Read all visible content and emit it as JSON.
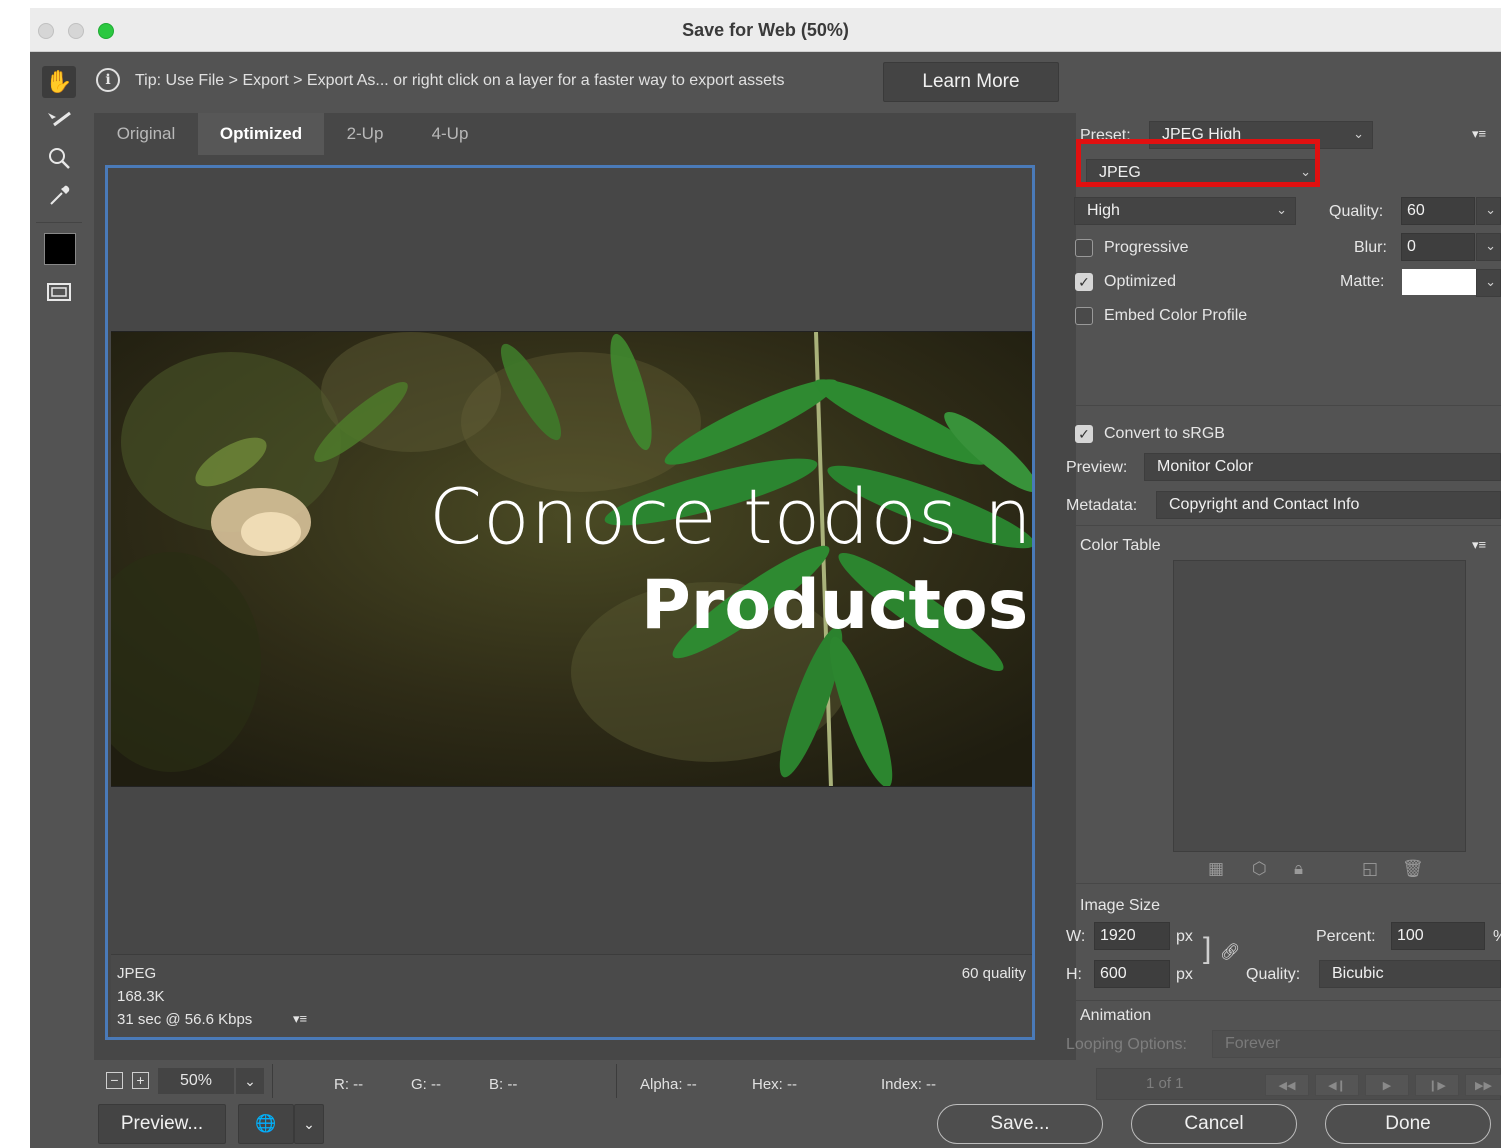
{
  "window": {
    "title": "Save for Web (50%)"
  },
  "tip": {
    "text": "Tip: Use File > Export > Export As...  or right click on a layer for a faster way to export assets",
    "learn_more": "Learn More"
  },
  "tabs": [
    "Original",
    "Optimized",
    "2-Up",
    "4-Up"
  ],
  "image": {
    "line1": "Conoce todos nu",
    "line2": "Productos"
  },
  "status": {
    "format": "JPEG",
    "size": "168.3K",
    "time": "31 sec @ 56.6 Kbps",
    "quality": "60 quality"
  },
  "zoom": {
    "value": "50%"
  },
  "readouts": {
    "r": "R: --",
    "g": "G: --",
    "b": "B: --",
    "alpha": "Alpha: --",
    "hex": "Hex: --",
    "index": "Index: --"
  },
  "buttons": {
    "preview": "Preview...",
    "save": "Save...",
    "cancel": "Cancel",
    "done": "Done"
  },
  "settings": {
    "preset_label": "Preset:",
    "preset_value": "JPEG High",
    "format": "JPEG",
    "compression": "High",
    "quality_label": "Quality:",
    "quality_value": "60",
    "blur_label": "Blur:",
    "blur_value": "0",
    "matte_label": "Matte:",
    "progressive": "Progressive",
    "optimized": "Optimized",
    "embed_profile": "Embed Color Profile",
    "convert_srgb": "Convert to sRGB",
    "preview_label": "Preview:",
    "preview_value": "Monitor Color",
    "metadata_label": "Metadata:",
    "metadata_value": "Copyright and Contact Info",
    "color_table": "Color Table"
  },
  "image_size": {
    "heading": "Image Size",
    "w_label": "W:",
    "w_value": "1920",
    "h_label": "H:",
    "h_value": "600",
    "unit": "px",
    "percent_label": "Percent:",
    "percent_value": "100",
    "percent_sign": "%",
    "quality_label": "Quality:",
    "quality_value": "Bicubic"
  },
  "animation": {
    "heading": "Animation",
    "looping_label": "Looping Options:",
    "looping_value": "Forever",
    "frame": "1 of 1"
  },
  "colors": {
    "bg": "#535353",
    "highlight": "#e11010",
    "frame_border": "#4a7ab8"
  },
  "icons": [
    "hand-icon",
    "slice-select-icon",
    "zoom-icon",
    "eyedropper-icon",
    "eyedropper-color-swatch",
    "slice-visibility-icon",
    "info-icon",
    "panel-menu-icon",
    "link-icon",
    "browser-preview-icon"
  ]
}
